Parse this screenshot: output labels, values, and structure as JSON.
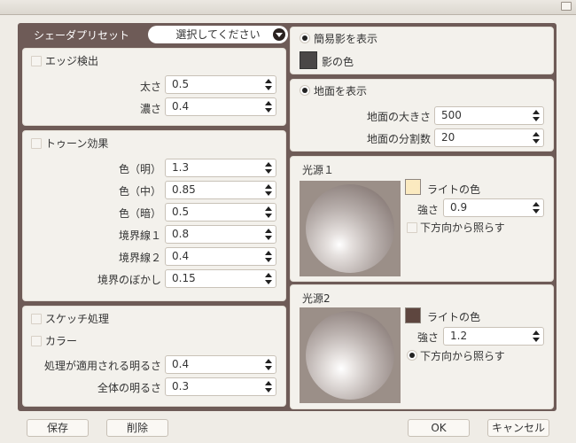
{
  "window": {
    "close_icon": "close-icon"
  },
  "preset": {
    "label": "シェーダプリセット",
    "value": "選択してください"
  },
  "edge": {
    "check_label": "エッジ検出",
    "checked": false,
    "fields": [
      {
        "label": "太さ",
        "value": "0.5"
      },
      {
        "label": "濃さ",
        "value": "0.4"
      }
    ]
  },
  "toon": {
    "check_label": "トゥーン効果",
    "checked": false,
    "fields": [
      {
        "label": "色（明）",
        "value": "1.3"
      },
      {
        "label": "色（中）",
        "value": "0.85"
      },
      {
        "label": "色（暗）",
        "value": "0.5"
      },
      {
        "label": "境界線１",
        "value": "0.8"
      },
      {
        "label": "境界線２",
        "value": "0.4"
      },
      {
        "label": "境界のぼかし",
        "value": "0.15"
      }
    ]
  },
  "sketch": {
    "check_label": "スケッチ処理",
    "checked": false,
    "color_label": "カラー",
    "color_checked": false,
    "fields": [
      {
        "label": "処理が適用される明るさ",
        "value": "0.4"
      },
      {
        "label": "全体の明るさ",
        "value": "0.3"
      }
    ]
  },
  "shadow": {
    "radio_label": "簡易影を表示",
    "color_label": "影の色",
    "color": "#4a4747"
  },
  "ground": {
    "radio_label": "地面を表示",
    "fields": [
      {
        "label": "地面の大きさ",
        "value": "500"
      },
      {
        "label": "地面の分割数",
        "value": "20"
      }
    ]
  },
  "light1": {
    "title": "光源１",
    "color_label": "ライトの色",
    "color": "#fbeac0",
    "strength_label": "強さ",
    "strength": "0.9",
    "from_below_label": "下方向から照らす",
    "from_below": false
  },
  "light2": {
    "title": "光源2",
    "color_label": "ライトの色",
    "color": "#5e463f",
    "strength_label": "強さ",
    "strength": "1.2",
    "from_below_label": "下方向から照らす",
    "from_below": true
  },
  "buttons": {
    "save": "保存",
    "delete": "削除",
    "ok": "OK",
    "cancel": "キャンセル"
  },
  "colors": {
    "frame": "#6e5b57",
    "panel": "#f3f1ec",
    "window_bg": "#efece6"
  }
}
